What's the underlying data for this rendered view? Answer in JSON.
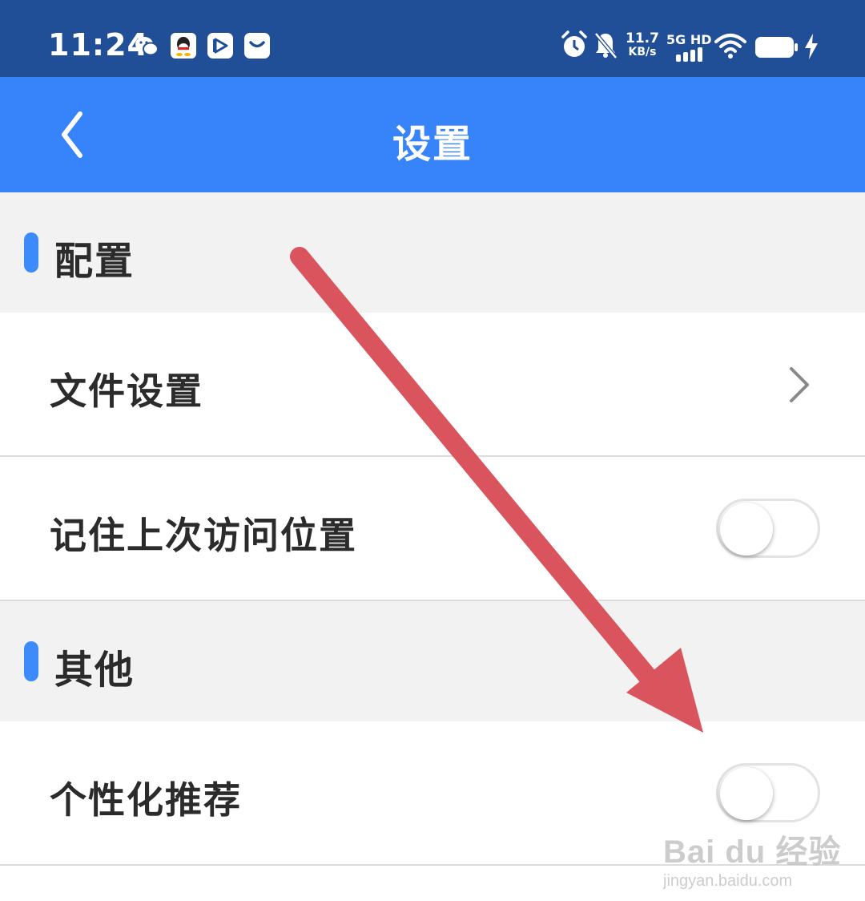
{
  "status_bar": {
    "time": "11:24",
    "speed_value": "11.7",
    "speed_unit": "KB/s",
    "network": "5G HD",
    "icons": [
      "wechat-icon",
      "qq-icon",
      "video-app-icon",
      "message-app-icon",
      "alarm-icon",
      "mute-icon",
      "signal-icon",
      "wifi-icon",
      "battery-icon",
      "charging-icon"
    ],
    "background": "#214f97"
  },
  "app_bar": {
    "title": "设置",
    "back_icon": "back-chevron-icon",
    "background": "#3783fa"
  },
  "sections": [
    {
      "title": "配置",
      "rows": [
        {
          "label": "文件设置",
          "control": "chevron-right-icon"
        },
        {
          "label": "记住上次访问位置",
          "control": "toggle",
          "checked": false
        }
      ]
    },
    {
      "title": "其他",
      "rows": [
        {
          "label": "个性化推荐",
          "control": "toggle",
          "checked": false
        }
      ]
    }
  ],
  "annotation": {
    "type": "arrow",
    "color": "#d9545c"
  },
  "watermark": {
    "logo": "Bai du 经验",
    "url": "jingyan.baidu.com"
  }
}
